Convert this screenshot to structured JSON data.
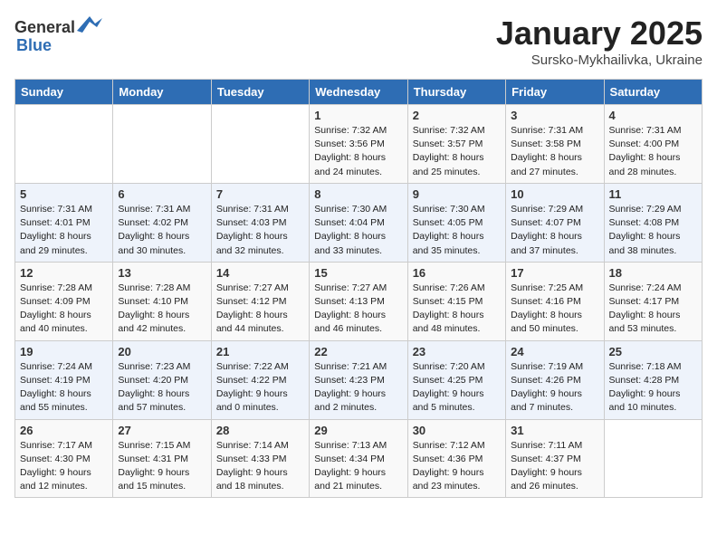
{
  "logo": {
    "text_general": "General",
    "text_blue": "Blue"
  },
  "header": {
    "month_year": "January 2025",
    "location": "Sursko-Mykhailivka, Ukraine"
  },
  "weekdays": [
    "Sunday",
    "Monday",
    "Tuesday",
    "Wednesday",
    "Thursday",
    "Friday",
    "Saturday"
  ],
  "weeks": [
    [
      {
        "day": "",
        "info": ""
      },
      {
        "day": "",
        "info": ""
      },
      {
        "day": "",
        "info": ""
      },
      {
        "day": "1",
        "info": "Sunrise: 7:32 AM\nSunset: 3:56 PM\nDaylight: 8 hours\nand 24 minutes."
      },
      {
        "day": "2",
        "info": "Sunrise: 7:32 AM\nSunset: 3:57 PM\nDaylight: 8 hours\nand 25 minutes."
      },
      {
        "day": "3",
        "info": "Sunrise: 7:31 AM\nSunset: 3:58 PM\nDaylight: 8 hours\nand 27 minutes."
      },
      {
        "day": "4",
        "info": "Sunrise: 7:31 AM\nSunset: 4:00 PM\nDaylight: 8 hours\nand 28 minutes."
      }
    ],
    [
      {
        "day": "5",
        "info": "Sunrise: 7:31 AM\nSunset: 4:01 PM\nDaylight: 8 hours\nand 29 minutes."
      },
      {
        "day": "6",
        "info": "Sunrise: 7:31 AM\nSunset: 4:02 PM\nDaylight: 8 hours\nand 30 minutes."
      },
      {
        "day": "7",
        "info": "Sunrise: 7:31 AM\nSunset: 4:03 PM\nDaylight: 8 hours\nand 32 minutes."
      },
      {
        "day": "8",
        "info": "Sunrise: 7:30 AM\nSunset: 4:04 PM\nDaylight: 8 hours\nand 33 minutes."
      },
      {
        "day": "9",
        "info": "Sunrise: 7:30 AM\nSunset: 4:05 PM\nDaylight: 8 hours\nand 35 minutes."
      },
      {
        "day": "10",
        "info": "Sunrise: 7:29 AM\nSunset: 4:07 PM\nDaylight: 8 hours\nand 37 minutes."
      },
      {
        "day": "11",
        "info": "Sunrise: 7:29 AM\nSunset: 4:08 PM\nDaylight: 8 hours\nand 38 minutes."
      }
    ],
    [
      {
        "day": "12",
        "info": "Sunrise: 7:28 AM\nSunset: 4:09 PM\nDaylight: 8 hours\nand 40 minutes."
      },
      {
        "day": "13",
        "info": "Sunrise: 7:28 AM\nSunset: 4:10 PM\nDaylight: 8 hours\nand 42 minutes."
      },
      {
        "day": "14",
        "info": "Sunrise: 7:27 AM\nSunset: 4:12 PM\nDaylight: 8 hours\nand 44 minutes."
      },
      {
        "day": "15",
        "info": "Sunrise: 7:27 AM\nSunset: 4:13 PM\nDaylight: 8 hours\nand 46 minutes."
      },
      {
        "day": "16",
        "info": "Sunrise: 7:26 AM\nSunset: 4:15 PM\nDaylight: 8 hours\nand 48 minutes."
      },
      {
        "day": "17",
        "info": "Sunrise: 7:25 AM\nSunset: 4:16 PM\nDaylight: 8 hours\nand 50 minutes."
      },
      {
        "day": "18",
        "info": "Sunrise: 7:24 AM\nSunset: 4:17 PM\nDaylight: 8 hours\nand 53 minutes."
      }
    ],
    [
      {
        "day": "19",
        "info": "Sunrise: 7:24 AM\nSunset: 4:19 PM\nDaylight: 8 hours\nand 55 minutes."
      },
      {
        "day": "20",
        "info": "Sunrise: 7:23 AM\nSunset: 4:20 PM\nDaylight: 8 hours\nand 57 minutes."
      },
      {
        "day": "21",
        "info": "Sunrise: 7:22 AM\nSunset: 4:22 PM\nDaylight: 9 hours\nand 0 minutes."
      },
      {
        "day": "22",
        "info": "Sunrise: 7:21 AM\nSunset: 4:23 PM\nDaylight: 9 hours\nand 2 minutes."
      },
      {
        "day": "23",
        "info": "Sunrise: 7:20 AM\nSunset: 4:25 PM\nDaylight: 9 hours\nand 5 minutes."
      },
      {
        "day": "24",
        "info": "Sunrise: 7:19 AM\nSunset: 4:26 PM\nDaylight: 9 hours\nand 7 minutes."
      },
      {
        "day": "25",
        "info": "Sunrise: 7:18 AM\nSunset: 4:28 PM\nDaylight: 9 hours\nand 10 minutes."
      }
    ],
    [
      {
        "day": "26",
        "info": "Sunrise: 7:17 AM\nSunset: 4:30 PM\nDaylight: 9 hours\nand 12 minutes."
      },
      {
        "day": "27",
        "info": "Sunrise: 7:15 AM\nSunset: 4:31 PM\nDaylight: 9 hours\nand 15 minutes."
      },
      {
        "day": "28",
        "info": "Sunrise: 7:14 AM\nSunset: 4:33 PM\nDaylight: 9 hours\nand 18 minutes."
      },
      {
        "day": "29",
        "info": "Sunrise: 7:13 AM\nSunset: 4:34 PM\nDaylight: 9 hours\nand 21 minutes."
      },
      {
        "day": "30",
        "info": "Sunrise: 7:12 AM\nSunset: 4:36 PM\nDaylight: 9 hours\nand 23 minutes."
      },
      {
        "day": "31",
        "info": "Sunrise: 7:11 AM\nSunset: 4:37 PM\nDaylight: 9 hours\nand 26 minutes."
      },
      {
        "day": "",
        "info": ""
      }
    ]
  ]
}
